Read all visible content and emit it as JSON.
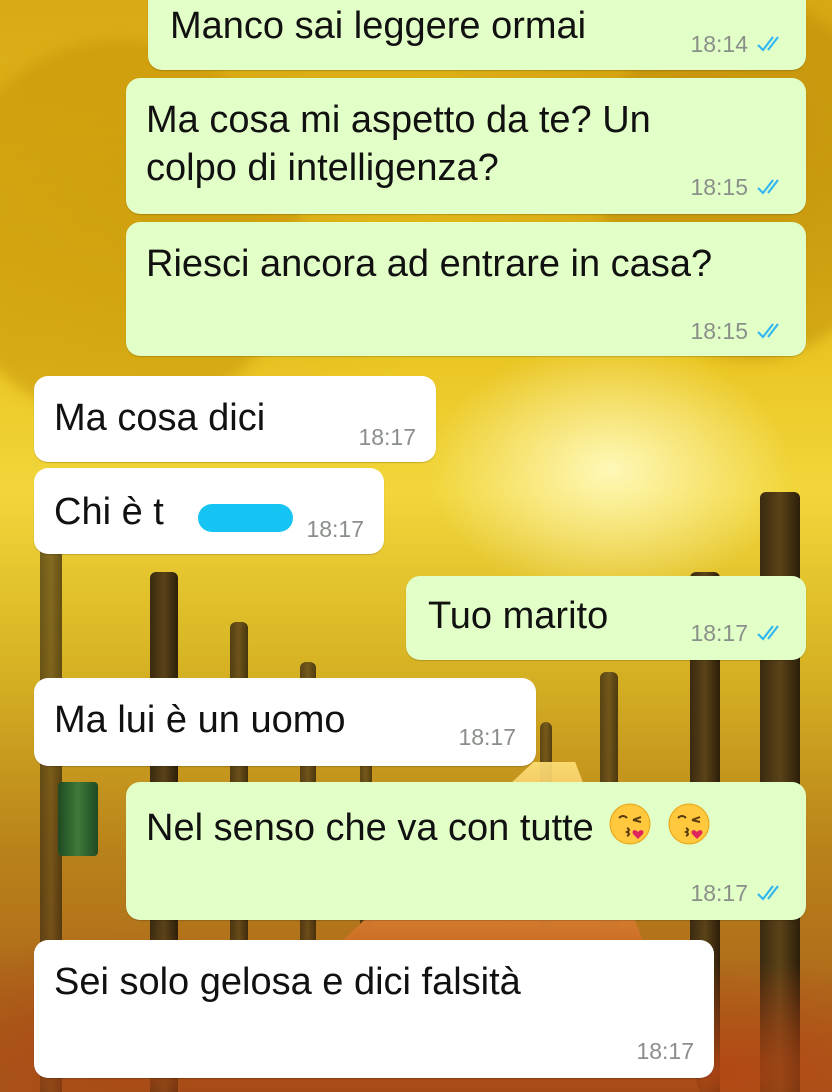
{
  "colors": {
    "outgoing_bubble": "#e2ffc7",
    "incoming_bubble": "#ffffff",
    "read_ticks": "#34b7f1",
    "timestamp": "#8a8f8a",
    "redaction": "#16c4f4"
  },
  "messages": [
    {
      "direction": "out",
      "text": "Manco sai leggere ormai",
      "time": "18:14",
      "status": "read"
    },
    {
      "direction": "out",
      "text_line1": "Ma cosa mi aspetto da te? Un",
      "text_line2": "colpo di intelligenza?",
      "time": "18:15",
      "status": "read"
    },
    {
      "direction": "out",
      "text": "Riesci ancora ad entrare in casa?",
      "time": "18:15",
      "status": "read"
    },
    {
      "direction": "in",
      "text": "Ma cosa dici",
      "time": "18:17"
    },
    {
      "direction": "in",
      "text": "Chi è t",
      "time": "18:17",
      "redacted": true
    },
    {
      "direction": "out",
      "text": "Tuo marito",
      "time": "18:17",
      "status": "read"
    },
    {
      "direction": "in",
      "text": "Ma lui è un uomo",
      "time": "18:17"
    },
    {
      "direction": "out",
      "text": "Nel senso che va con tutte",
      "emoji": [
        "kissing-face-icon",
        "kissing-face-icon"
      ],
      "time": "18:17",
      "status": "read"
    },
    {
      "direction": "in",
      "text": "Sei solo gelosa e dici falsità",
      "time": "18:17"
    }
  ]
}
